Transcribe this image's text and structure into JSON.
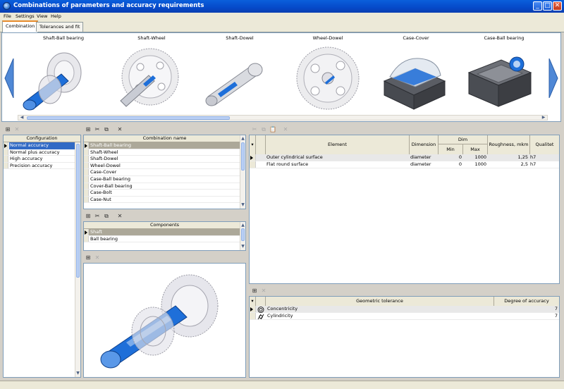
{
  "window": {
    "title": "Combinations of parameters and accuracy requirements"
  },
  "menu": [
    "File",
    "Settings",
    "View",
    "Help"
  ],
  "tabs": [
    "Combination",
    "Tolerances and fit"
  ],
  "gallery": {
    "items": [
      "Shaft-Ball bearing",
      "Shaft-Wheel",
      "Shaft-Dowel",
      "Wheel-Dowel",
      "Case-Cover",
      "Case-Ball bearing"
    ]
  },
  "configuration": {
    "header": "Configuration",
    "rows": [
      "Normal accuracy",
      "Normal plus accuracy",
      "High accuracy",
      "Precision accuracy"
    ],
    "selected": 0
  },
  "combinations": {
    "header": "Combination name",
    "rows": [
      "Shaft-Ball bearing",
      "Shaft-Wheel",
      "Shaft-Dowel",
      "Wheel-Dowel",
      "Case-Cover",
      "Case-Ball bearing",
      "Cover-Ball bearing",
      "Case-Bolt",
      "Case-Nut"
    ],
    "selected": 0
  },
  "components": {
    "header": "Components",
    "rows": [
      "Shaft",
      "Ball bearing"
    ],
    "selected": 0
  },
  "elements": {
    "headers": {
      "element": "Element",
      "dimension": "Dimension",
      "dim": "Dim",
      "min": "Min",
      "max": "Max",
      "roughness": "Roughness, mkm",
      "qualitet": "Qualitet"
    },
    "rows": [
      {
        "element": "Outer cylindrical surface",
        "dimension": "diameter",
        "min": "0",
        "max": "1000",
        "roughness": "1,25",
        "qualitet": "h7"
      },
      {
        "element": "Flat round surface",
        "dimension": "diameter",
        "min": "0",
        "max": "1000",
        "roughness": "2,5",
        "qualitet": "h7"
      }
    ]
  },
  "geometric": {
    "headers": {
      "tolerance": "Geometric tolerance",
      "degree": "Degree of accuracy"
    },
    "rows": [
      {
        "icon": "concentricity-icon",
        "name": "Concentricity",
        "degree": "7"
      },
      {
        "icon": "cylindricity-icon",
        "name": "Cylindricity",
        "degree": "7"
      }
    ]
  },
  "colors": {
    "title_bar": "#0a5fdc",
    "selection": "#aca899",
    "accent_blue": "#316ac5",
    "part_blue": "#1e6fd9"
  }
}
